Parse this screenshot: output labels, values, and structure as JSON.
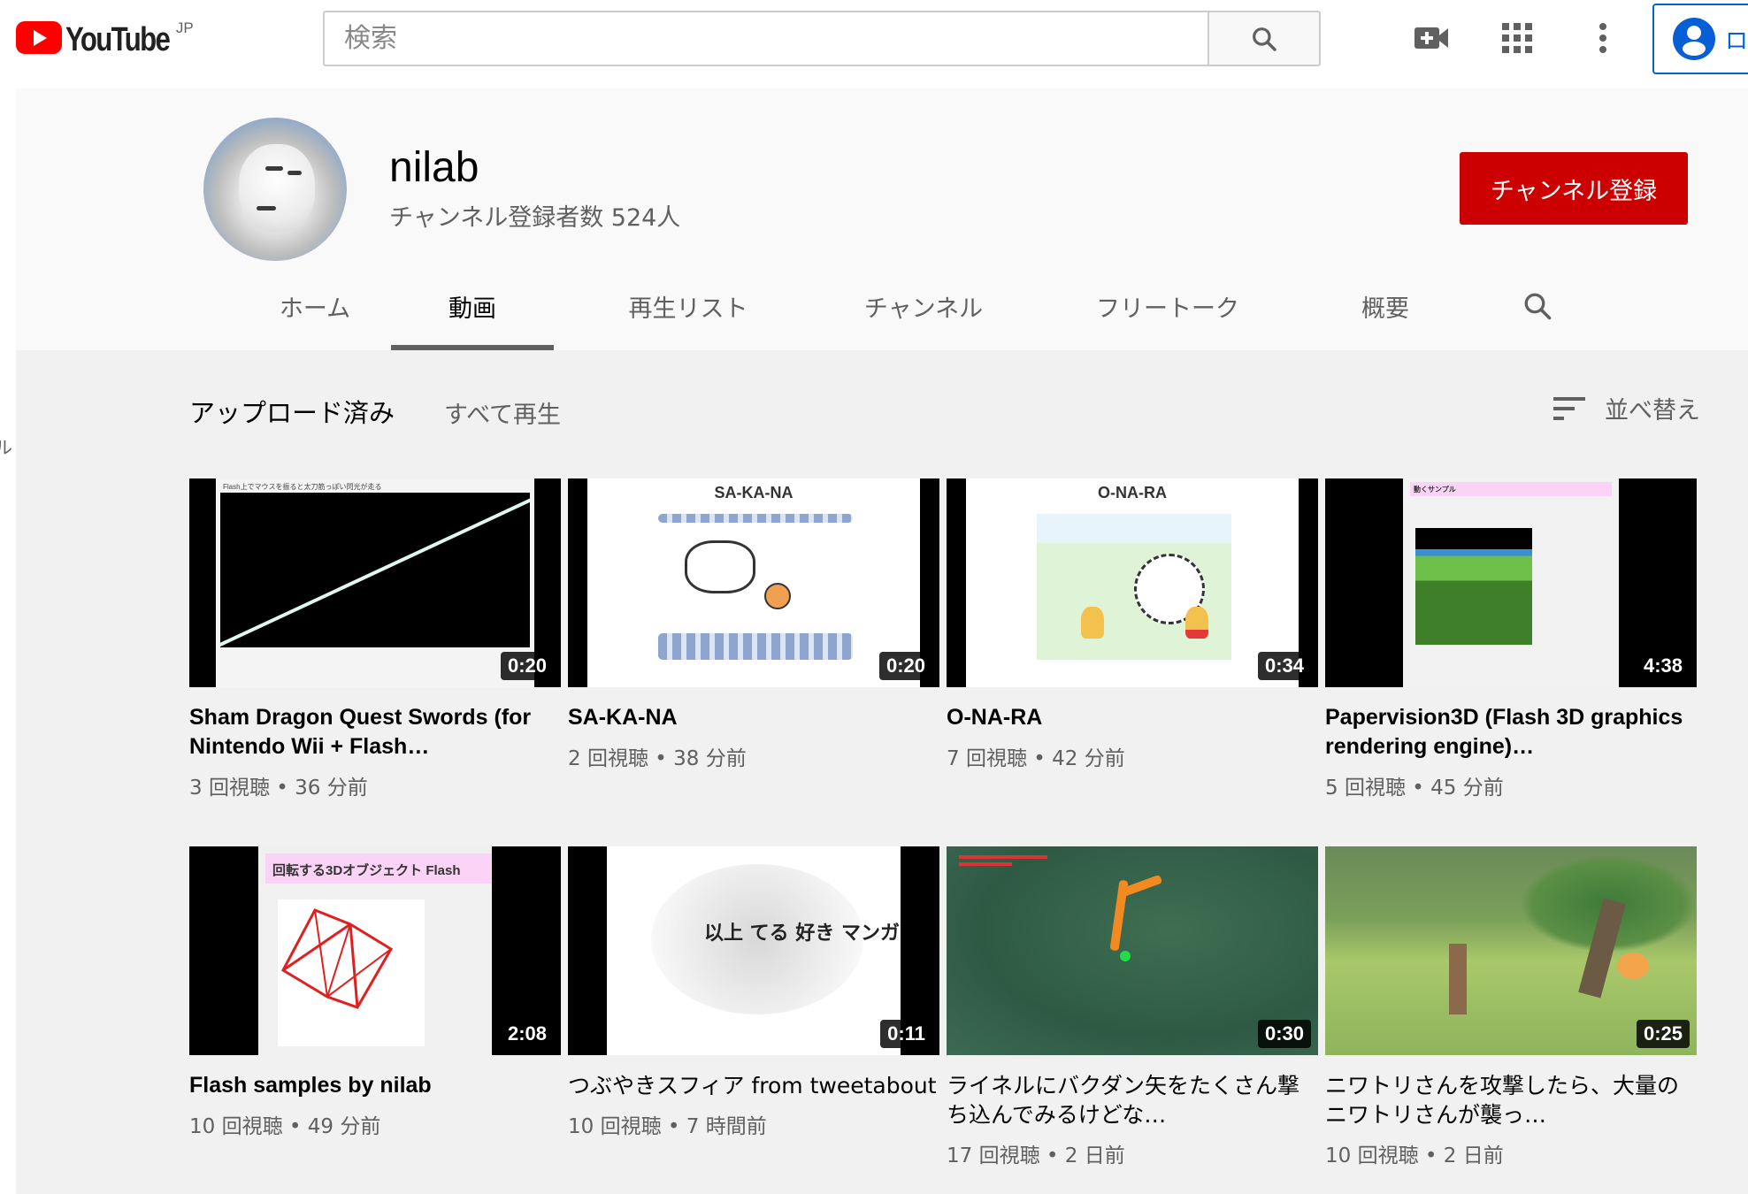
{
  "masthead": {
    "logo_text": "YouTube",
    "region": "JP",
    "search_placeholder": "検索",
    "signin_partial": "ロ"
  },
  "channel": {
    "name": "nilab",
    "subscribers": "チャンネル登録者数 524人",
    "subscribe_label": "チャンネル登録",
    "subscribe_color": "#cc0000"
  },
  "tabs": [
    {
      "label": "ホーム",
      "active": false
    },
    {
      "label": "動画",
      "active": true
    },
    {
      "label": "再生リスト",
      "active": false
    },
    {
      "label": "チャンネル",
      "active": false
    },
    {
      "label": "フリートーク",
      "active": false
    },
    {
      "label": "概要",
      "active": false
    }
  ],
  "sidebar_edge_text": "ル",
  "section": {
    "title": "アップロード済み",
    "play_all": "すべて再生",
    "sort_label": "並べ替え"
  },
  "videos": [
    {
      "title": "Sham Dragon Quest Swords (for Nintendo Wii + Flash…",
      "views": "3 回視聴",
      "age": "36 分前",
      "duration": "0:20",
      "thumb_caption": "Flash上でマウスを振ると太刀筋っぽい閃光が走る"
    },
    {
      "title": "SA-KA-NA",
      "views": "2 回視聴",
      "age": "38 分前",
      "duration": "0:20",
      "thumb_caption": "SA-KA-NA"
    },
    {
      "title": "O-NA-RA",
      "views": "7 回視聴",
      "age": "42 分前",
      "duration": "0:34",
      "thumb_caption": "O-NA-RA"
    },
    {
      "title": "Papervision3D (Flash 3D graphics rendering engine)…",
      "views": "5 回視聴",
      "age": "45 分前",
      "duration": "4:38",
      "thumb_caption": "動くサンプル"
    },
    {
      "title": "Flash samples by nilab",
      "views": "10 回視聴",
      "age": "49 分前",
      "duration": "2:08",
      "thumb_caption": "回転する3Dオブジェクト Flash"
    },
    {
      "title": "つぶやきスフィア from tweetabout",
      "views": "10 回視聴",
      "age": "7 時間前",
      "duration": "0:11",
      "thumb_caption": "以上 てる 好き マンガ"
    },
    {
      "title": "ライネルにバクダン矢をたくさん撃ち込んでみるけどな…",
      "views": "17 回視聴",
      "age": "2 日前",
      "duration": "0:30",
      "thumb_caption": ""
    },
    {
      "title": "ニワトリさんを攻撃したら、大量のニワトリさんが襲っ…",
      "views": "10 回視聴",
      "age": "2 日前",
      "duration": "0:25",
      "thumb_caption": ""
    }
  ],
  "meta_separator": " • "
}
